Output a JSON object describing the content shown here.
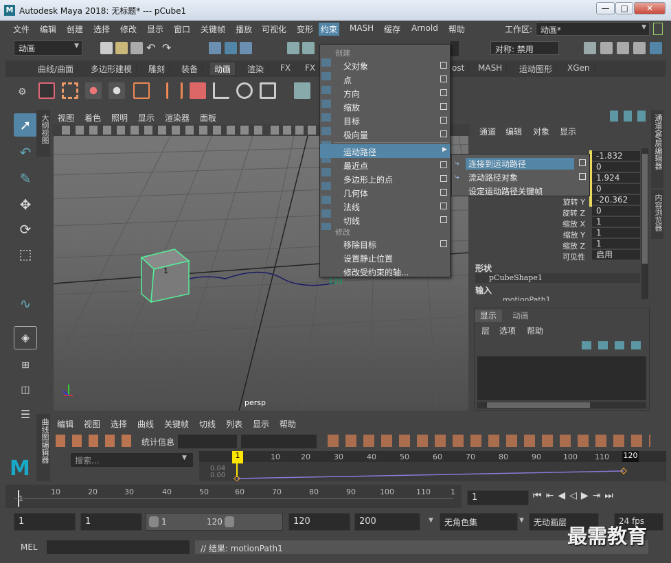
{
  "window": {
    "title": "Autodesk Maya 2018: 无标题*   ---   pCube1",
    "logo": "M",
    "min": "—",
    "max": "□",
    "close": "✕"
  },
  "menubar": {
    "items": [
      "文件",
      "编辑",
      "创建",
      "选择",
      "修改",
      "显示",
      "窗口",
      "关键帧",
      "播放",
      "可视化",
      "变形",
      "约束",
      "MASH",
      "缓存",
      "Arnold",
      "帮助"
    ],
    "workspace_label": "工作区:",
    "workspace_value": "动画*"
  },
  "statusline": {
    "mode": "动画",
    "symmetry": "对称: 禁用"
  },
  "shelf_tabs": [
    "曲线/曲面",
    "多边形建模",
    "雕刻",
    "装备",
    "动画",
    "渲染",
    "FX",
    "FX",
    "ost",
    "MASH",
    "运动图形",
    "XGen"
  ],
  "viewport": {
    "menus": [
      "视图",
      "着色",
      "照明",
      "显示",
      "渲染器",
      "面板"
    ],
    "camera": "persp",
    "cube_label": "1",
    "curve_label": "120"
  },
  "constrain_menu": {
    "section_create": "创建",
    "items": [
      {
        "label": "父对象"
      },
      {
        "label": "点"
      },
      {
        "label": "方向"
      },
      {
        "label": "缩放"
      },
      {
        "label": "目标"
      },
      {
        "label": "极向量"
      },
      {
        "label": "运动路径",
        "submenu": true
      },
      {
        "label": "最近点"
      },
      {
        "label": "多边形上的点"
      },
      {
        "label": "几何体"
      },
      {
        "label": "法线"
      },
      {
        "label": "切线"
      }
    ],
    "section_modify": "修改",
    "modify_items": [
      {
        "label": "移除目标"
      },
      {
        "label": "设置静止位置"
      },
      {
        "label": "修改受约束的轴..."
      }
    ]
  },
  "motion_path_submenu": [
    "连接到运动路径",
    "流动路径对象",
    "设定运动路径关键帧"
  ],
  "channelbox": {
    "menus": [
      "通道",
      "编辑",
      "对象",
      "显示"
    ],
    "values": [
      "-1.832",
      "0",
      "1.924",
      "0",
      "-20.362",
      "0",
      "1",
      "1",
      "1",
      "启用"
    ],
    "labels": [
      "",
      "",
      "",
      "",
      "旋转 Y",
      "旋转 Z",
      "缩放 X",
      "缩放 Y",
      "缩放 Z",
      "可见性"
    ],
    "shape_header": "形状",
    "shape_name": "pCubeShape1",
    "input_header": "输入",
    "input_name": "motionPath1"
  },
  "layers": {
    "tabs": [
      "显示",
      "动画"
    ],
    "menus": [
      "层",
      "选项",
      "帮助"
    ]
  },
  "side_tabs": {
    "right1": "通道盒/层编辑器",
    "right2": "内容浏览器",
    "left": "大纲视图",
    "graph": "曲线图编辑器"
  },
  "graph_editor": {
    "menus": [
      "编辑",
      "视图",
      "选择",
      "曲线",
      "关键帧",
      "切线",
      "列表",
      "显示",
      "帮助"
    ],
    "stats": "统计信息",
    "search_placeholder": "搜索...",
    "key_start": "1",
    "key_end": "120",
    "ticks": [
      "10",
      "20",
      "30",
      "40",
      "50",
      "60",
      "70",
      "80",
      "90",
      "100",
      "110"
    ],
    "ylabels": [
      "0.04",
      "0.00"
    ]
  },
  "timeslider": {
    "ticks": [
      "1",
      "10",
      "20",
      "30",
      "40",
      "50",
      "60",
      "70",
      "80",
      "90",
      "100",
      "110",
      "1"
    ],
    "current": "1"
  },
  "range": {
    "start": "1",
    "anim_start": "1",
    "slider_start": "1",
    "slider_end": "120",
    "anim_end": "120",
    "end": "200",
    "char_set": "无角色集",
    "anim_layer": "无动画层",
    "fps": "24 fps"
  },
  "commandline": {
    "lang": "MEL",
    "result": "// 结果: motionPath1"
  },
  "watermark": "最需教育",
  "colors": {
    "accent": "#5285a6",
    "cube": "#55ee99",
    "curve": "#1a1a66",
    "key": "#ffe600"
  }
}
